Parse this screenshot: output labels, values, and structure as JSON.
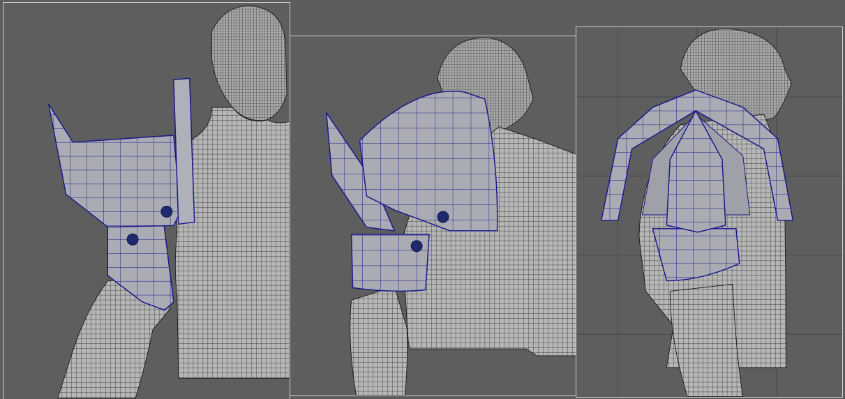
{
  "screen": {
    "description_visible_text": "",
    "viewports": [
      {
        "id": "front",
        "view": "front-perspective"
      },
      {
        "id": "three-quarter",
        "view": "three-quarter-perspective"
      },
      {
        "id": "side",
        "view": "side-orthographic",
        "grid": true
      }
    ]
  },
  "colors": {
    "background": "#5d5d5d",
    "viewport_border": "#cfcfcf",
    "mesh_fill": "#b4b4b4",
    "mesh_wire": "#1c1c1c",
    "armor_fill": "#a9a9b2",
    "armor_wire": "#1a1a8c",
    "grid_line": "#4a4a4a"
  }
}
